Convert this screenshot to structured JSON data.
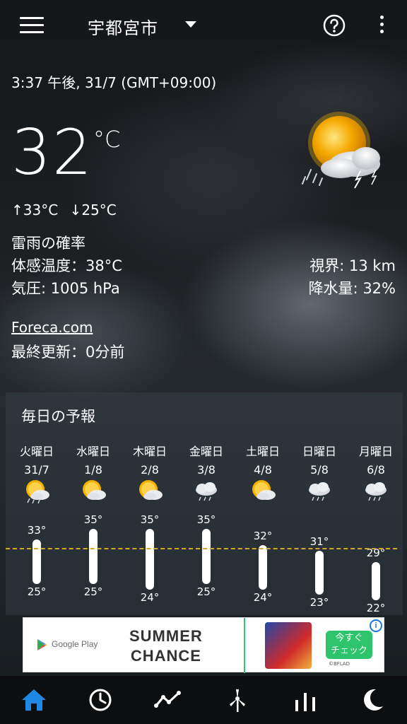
{
  "header": {
    "city": "宇都宮市",
    "menu_icon": "hamburger-menu-icon",
    "dropdown_icon": "caret-down-icon",
    "help_icon": "help-circle-icon",
    "more_icon": "more-vertical-icon"
  },
  "current": {
    "datetime": "3:37 午後, 31/7 (GMT+09:00)",
    "temperature": "32",
    "unit": "°C",
    "icon": "partly-sunny-thunderstorm-icon",
    "high": "33°C",
    "low": "25°C",
    "condition": "雷雨の確率",
    "feels_like": "体感温度：38°C",
    "pressure": "気圧: 1005 hPa",
    "visibility": "視界: 13 km",
    "precipitation": "降水量: 32%",
    "source": "Foreca.com",
    "last_update": "最終更新：0分前"
  },
  "daily": {
    "title": "毎日の予報",
    "days": [
      {
        "name": "火曜日",
        "date": "31/7",
        "icon": "partly-sunny-rain-icon",
        "high": "33°",
        "low": "25°",
        "high_val": 33,
        "low_val": 25
      },
      {
        "name": "水曜日",
        "date": "1/8",
        "icon": "partly-sunny-icon",
        "high": "35°",
        "low": "25°",
        "high_val": 35,
        "low_val": 25
      },
      {
        "name": "木曜日",
        "date": "2/8",
        "icon": "partly-sunny-icon",
        "high": "35°",
        "low": "24°",
        "high_val": 35,
        "low_val": 24
      },
      {
        "name": "金曜日",
        "date": "3/8",
        "icon": "cloud-rain-icon",
        "high": "35°",
        "low": "25°",
        "high_val": 35,
        "low_val": 25
      },
      {
        "name": "土曜日",
        "date": "4/8",
        "icon": "partly-sunny-icon",
        "high": "32°",
        "low": "24°",
        "high_val": 32,
        "low_val": 24
      },
      {
        "name": "日曜日",
        "date": "5/8",
        "icon": "cloud-rain-icon",
        "high": "31°",
        "low": "23°",
        "high_val": 31,
        "low_val": 23
      },
      {
        "name": "月曜日",
        "date": "6/8",
        "icon": "cloud-rain-icon",
        "high": "29°",
        "low": "22°",
        "high_val": 29,
        "low_val": 22
      }
    ]
  },
  "ad": {
    "store": "Google Play",
    "headline_1": "SUMMER",
    "headline_2": "CHANCE",
    "cta_1": "今すぐ",
    "cta_2": "チェック",
    "brand": "©BFLAD",
    "adchoices": "i"
  },
  "bottom_nav": [
    {
      "icon": "home-icon",
      "color": "#1e88e5"
    },
    {
      "icon": "clock-icon",
      "color": "#ffffff"
    },
    {
      "icon": "trend-chart-icon",
      "color": "#ffffff"
    },
    {
      "icon": "wind-turbine-icon",
      "color": "#ffffff"
    },
    {
      "icon": "bar-chart-icon",
      "color": "#ffffff"
    },
    {
      "icon": "moon-icon",
      "color": "#ffffff"
    }
  ]
}
